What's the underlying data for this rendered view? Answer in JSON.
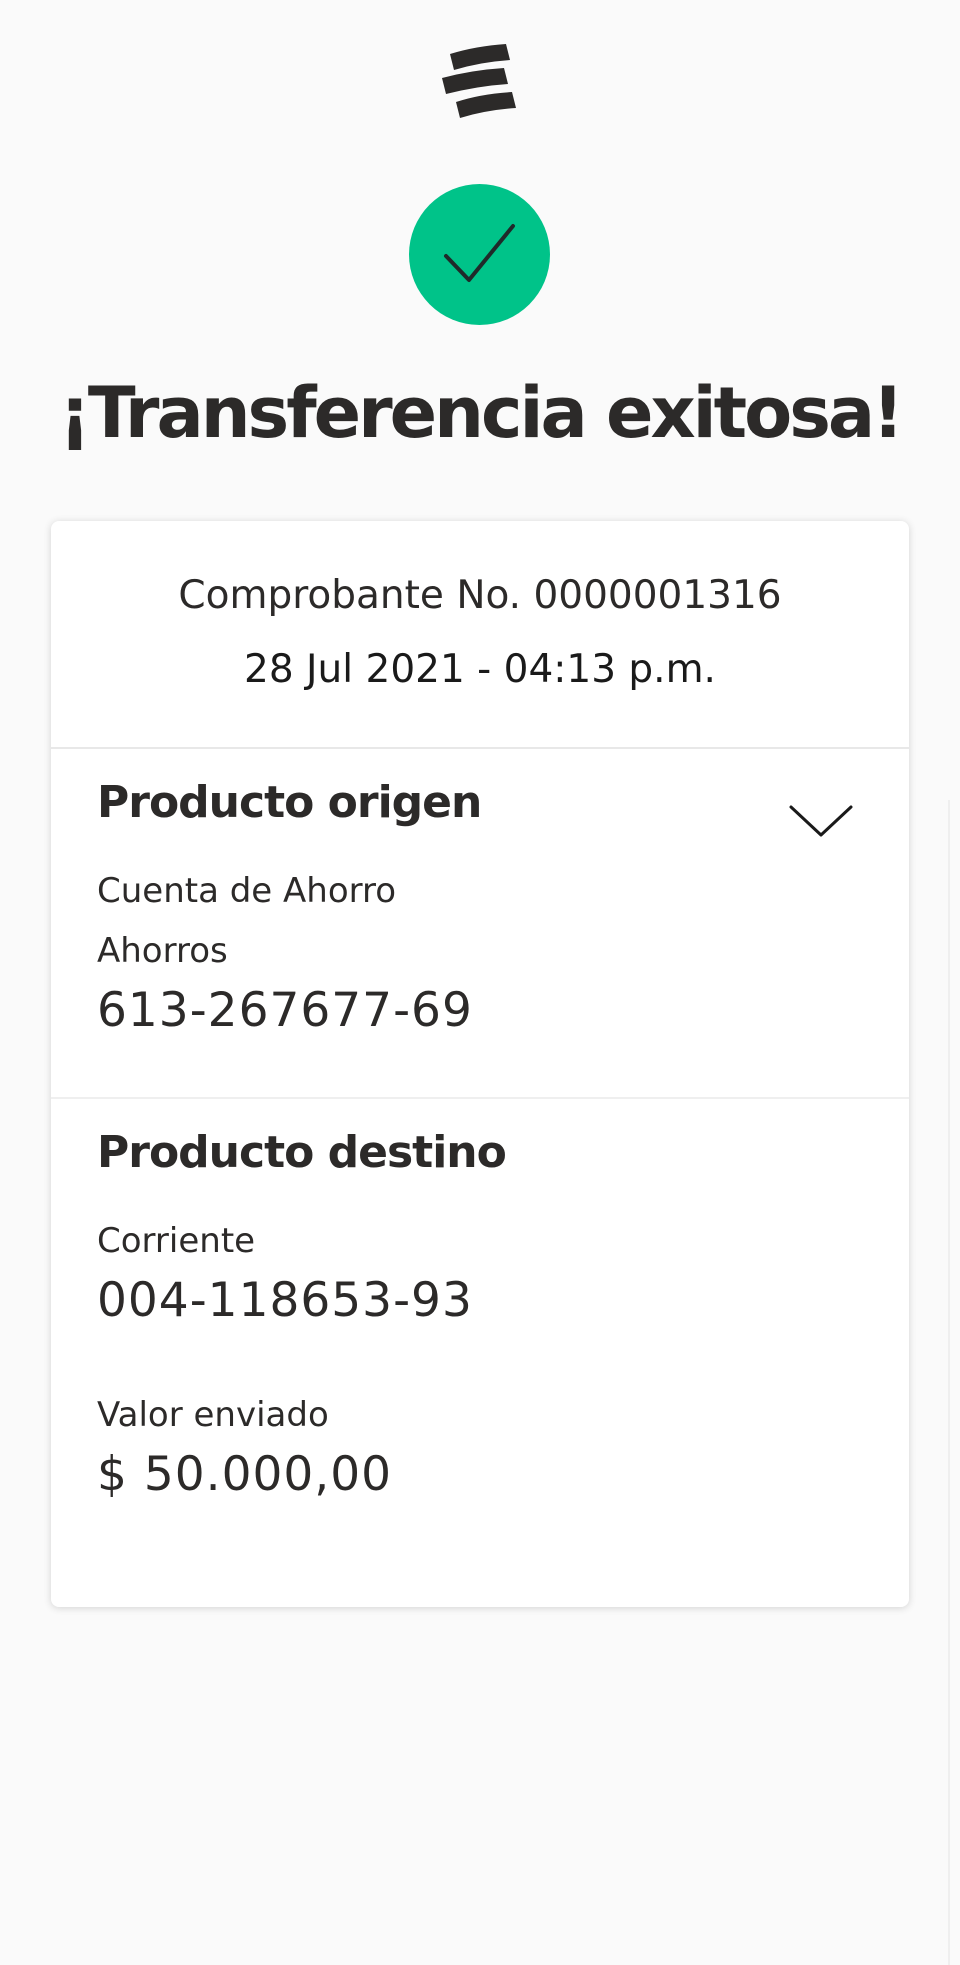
{
  "brand": {
    "logo_icon": "bank-logo-icon",
    "success_color": "#00c389",
    "text_color": "#2c2a29"
  },
  "status": {
    "icon": "check-icon",
    "title": "¡Transferencia exitosa!"
  },
  "receipt": {
    "number": "Comprobante No. 0000001316",
    "datetime": "28 Jul 2021 - 04:13 p.m."
  },
  "origin": {
    "title": "Producto origen",
    "expand_icon": "chevron-down-icon",
    "account_type": "Cuenta de Ahorro",
    "subtype": "Ahorros",
    "account_number": "613-267677-69"
  },
  "destination": {
    "title": "Producto destino",
    "account_type": "Corriente",
    "account_number": "004-118653-93",
    "amount_label": "Valor enviado",
    "amount": "$ 50.000,00"
  }
}
